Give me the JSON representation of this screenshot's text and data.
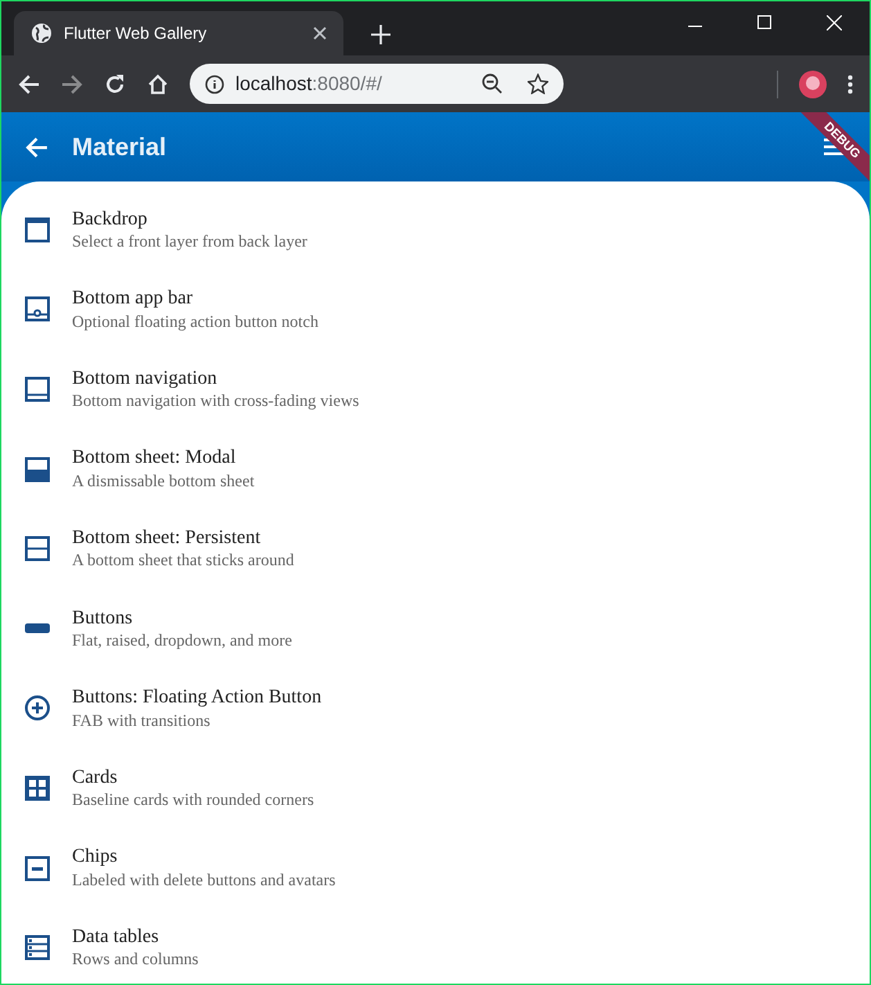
{
  "browser": {
    "tab_title": "Flutter Web Gallery",
    "url_host": "localhost",
    "url_rest": ":8080/#/"
  },
  "app_bar": {
    "title": "Material",
    "debug_label": "DEBUG"
  },
  "items": [
    {
      "kind": "backdrop",
      "title": "Backdrop",
      "subtitle": "Select a front layer from back layer"
    },
    {
      "kind": "bottom_app_bar",
      "title": "Bottom app bar",
      "subtitle": "Optional floating action button notch"
    },
    {
      "kind": "bottom_navigation",
      "title": "Bottom navigation",
      "subtitle": "Bottom navigation with cross-fading views"
    },
    {
      "kind": "sheet_modal",
      "title": "Bottom sheet: Modal",
      "subtitle": "A dismissable bottom sheet"
    },
    {
      "kind": "sheet_persistent",
      "title": "Bottom sheet: Persistent",
      "subtitle": "A bottom sheet that sticks around"
    },
    {
      "kind": "buttons",
      "title": "Buttons",
      "subtitle": "Flat, raised, dropdown, and more"
    },
    {
      "kind": "fab",
      "title": "Buttons: Floating Action Button",
      "subtitle": "FAB with transitions"
    },
    {
      "kind": "cards",
      "title": "Cards",
      "subtitle": "Baseline cards with rounded corners"
    },
    {
      "kind": "chips",
      "title": "Chips",
      "subtitle": "Labeled with delete buttons and avatars"
    },
    {
      "kind": "data_tables",
      "title": "Data tables",
      "subtitle": "Rows and columns"
    }
  ]
}
